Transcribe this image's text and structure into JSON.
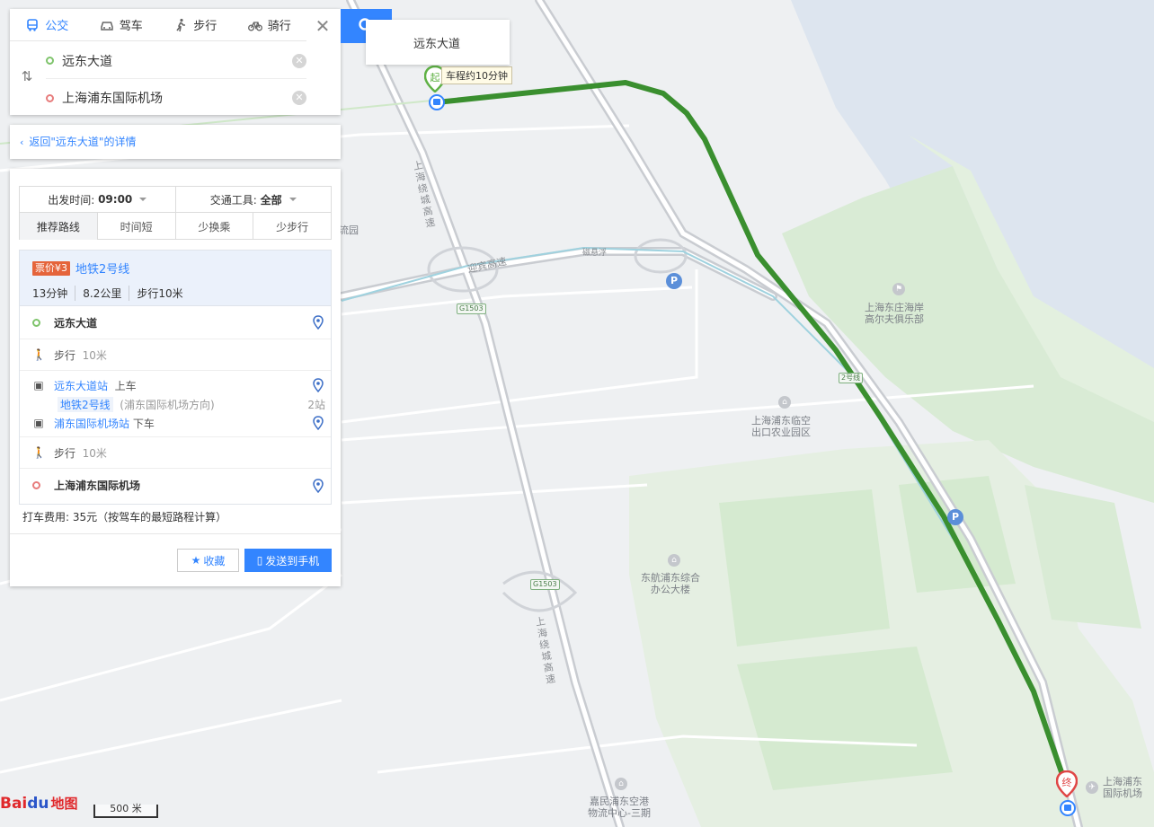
{
  "modes": [
    {
      "label": "公交",
      "icon": "bus-icon",
      "active": true
    },
    {
      "label": "驾车",
      "icon": "car-icon",
      "active": false
    },
    {
      "label": "步行",
      "icon": "walk-icon",
      "active": false
    },
    {
      "label": "骑行",
      "icon": "bike-icon",
      "active": false
    }
  ],
  "route_inputs": {
    "start": "远东大道",
    "end": "上海浦东国际机场"
  },
  "suggestion": "远东大道",
  "back_link": "返回\"远东大道\"的详情",
  "filters": {
    "depart_label": "出发时间:",
    "depart_value": "09:00",
    "transport_label": "交通工具:",
    "transport_value": "全部"
  },
  "sort_tabs": [
    "推荐路线",
    "时间短",
    "少换乘",
    "少步行"
  ],
  "route": {
    "fare": "票价¥3",
    "line": "地铁2号线",
    "duration": "13分钟",
    "distance": "8.2公里",
    "walk": "步行10米",
    "steps": {
      "origin": "远东大道",
      "walk1_label": "步行",
      "walk1_dist": "10米",
      "board_station": "远东大道站",
      "board_action": "上车",
      "line_tag": "地铁2号线",
      "direction": "(浦东国际机场方向)",
      "stops": "2站",
      "alight_station": "浦东国际机场站",
      "alight_action": "下车",
      "walk2_label": "步行",
      "walk2_dist": "10米",
      "destination": "上海浦东国际机场"
    }
  },
  "taxi_note": "打车费用: 35元（按驾车的最短路程计算）",
  "buttons": {
    "favorite": "收藏",
    "send": "发送到手机"
  },
  "map": {
    "start_marker": "起",
    "end_marker": "终",
    "drive_tooltip": "车程约10分钟",
    "labels": {
      "park_a": "流园",
      "golf": "上海东庄海岸\n高尔夫俱乐部",
      "agri": "上海浦东临空\n出口农业园区",
      "office": "东航浦东综合\n办公大楼",
      "logistics": "嘉民浦东空港\n物流中心-三期",
      "airport": "上海浦东\n国际机场"
    },
    "roads": {
      "yingbin": "迎宾高速",
      "ring_north": "上海绕城高速",
      "ring_south": "上海绕城高速",
      "ciyin": "磁悬浮",
      "line2": "2号线",
      "shield1": "G1503",
      "shield2": "G1503"
    },
    "scale_label": "500 米",
    "logo_text": "Bai",
    "logo_text2": "du",
    "logo_cn": "地图"
  },
  "colors": {
    "accent": "#3385ff",
    "route": "#3a8f2f",
    "water": "#dde5ef",
    "green": "#d5ead0"
  }
}
